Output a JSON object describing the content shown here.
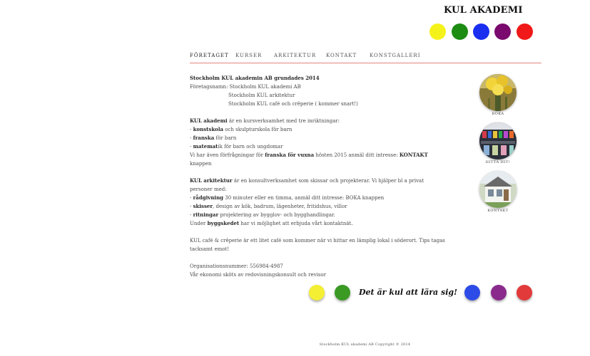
{
  "brand": "KUL AKADEMI",
  "colors": [
    "#f5f21a",
    "#1d8c12",
    "#1a2ef0",
    "#7a0a6e",
    "#f01818"
  ],
  "bottom_colors": [
    "#f4ef33",
    "#3a9a24",
    "#2d4be6",
    "#8a2a8c",
    "#e23a3a"
  ],
  "nav": [
    "FÖRETAGET",
    "KURSER",
    "ARKITEKTUR",
    "KONTAKT",
    "KONSTGALLERI"
  ],
  "content": {
    "heading": "Stockholm KUL akademin AB grundades 2014",
    "company_label": "Företagsnamn:",
    "company_names": [
      "Stockholm KUL akademi AB",
      "Stockholm KUL arkitektur",
      "Stockholm KUL café och crêperie ( kommer snart!)"
    ],
    "akademi": {
      "name": "KUL akademi",
      "intro": " är en kursverksamhet med tre inriktningar:",
      "items": [
        {
          "prefix": "- ",
          "bold": "konstskola",
          "rest": " och skulpturskola för barn"
        },
        {
          "prefix": "- ",
          "bold": "franska",
          "rest": " för barn"
        },
        {
          "prefix": "- ",
          "bold": "matemat",
          "rest": "ik för barn och ungdomar"
        }
      ],
      "extra_pre": "Vi har även förfrågningar för ",
      "extra_bold": "franska för vuxna",
      "extra_mid": " hösten 2015 anmäl ditt intresse: ",
      "extra_bold2": "KONTAKT",
      "extra_post": " knappen"
    },
    "arkitektur": {
      "name": "KUL arkitektur",
      "intro": " är en konsultverksamhet som skissar och projekterar. Vi hjälper bl a privat personer med:",
      "items": [
        {
          "prefix": "- ",
          "bold": "rådgivning",
          "rest": " 30 minuter eller en timma, anmäl ditt intresse: BOKA knappen"
        },
        {
          "prefix": "- ",
          "bold": "skisser",
          "rest": ", design av kök, badrum, lägenheter, fritidshus, villor"
        },
        {
          "prefix": "- ",
          "bold": "ritningar",
          "rest": " projektering av bygglov- och bygghandlingar."
        }
      ],
      "extra_pre": "Under ",
      "extra_bold": "byggskedet",
      "extra_post": " har vi möjlighet att erbjuda vårt kontaktnät."
    },
    "cafe": "KUL café & crêperie är ett litet café som kommer när vi hittar en lämplig lokal i söderort. Tips tagas tacksamt emot!",
    "org_label": "Organisationsnummer: 556984-4987",
    "economy": "Vår ekonomi sköts av redovisningskonsult och revisor"
  },
  "sidebar": [
    {
      "label": "BOKA",
      "icon": "flowers-photo"
    },
    {
      "label": "HITTA HIT!",
      "icon": "shop-window-photo"
    },
    {
      "label": "KONTAKT",
      "icon": "house-photo"
    }
  ],
  "slogan": "Det är kul att lära sig!",
  "footer": "Stockholm KUL akademi AB Copyright © 2014"
}
